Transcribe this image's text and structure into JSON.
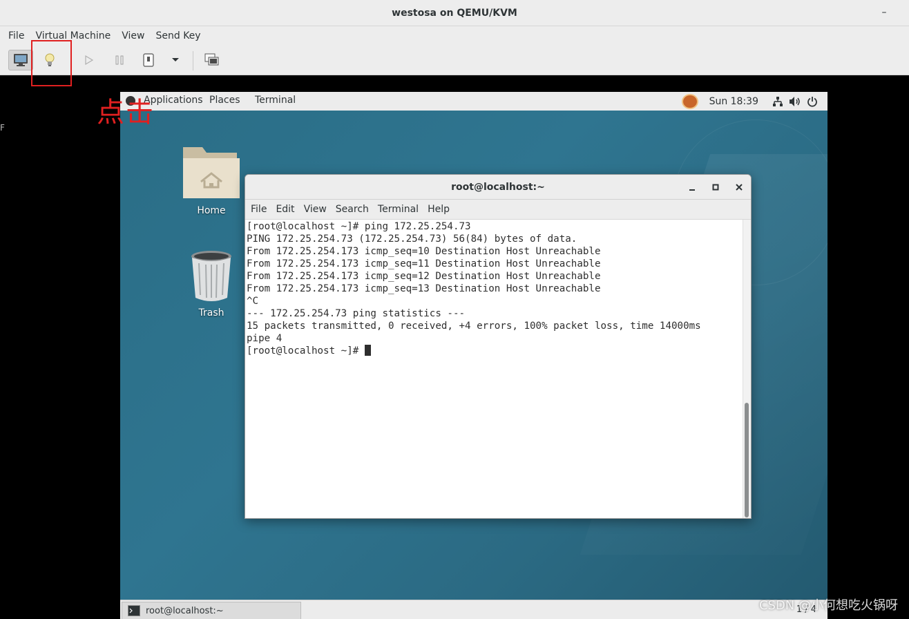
{
  "host": {
    "title": "westosa on QEMU/KVM",
    "minimize_glyph": "–",
    "menu": [
      "File",
      "Virtual Machine",
      "View",
      "Send Key"
    ],
    "toolbar_icons": [
      "monitor-icon",
      "lightbulb-icon",
      "play-icon",
      "pause-icon",
      "power-icon",
      "chevron-down-icon",
      "fullscreen-icon"
    ]
  },
  "annotation": {
    "text": "点击",
    "color": "#e02020"
  },
  "left_artifact": "F",
  "guest": {
    "topbar": {
      "applications": "Applications",
      "places": "Places",
      "terminal": "Terminal",
      "clock": "Sun 18:39"
    },
    "desktop_icons": [
      {
        "label": "Home",
        "icon": "home-folder-icon"
      },
      {
        "label": "Trash",
        "icon": "trash-icon"
      }
    ],
    "terminal_window": {
      "title": "root@localhost:~",
      "menu": [
        "File",
        "Edit",
        "View",
        "Search",
        "Terminal",
        "Help"
      ],
      "lines": [
        "[root@localhost ~]# ping 172.25.254.73",
        "PING 172.25.254.73 (172.25.254.73) 56(84) bytes of data.",
        "From 172.25.254.173 icmp_seq=10 Destination Host Unreachable",
        "From 172.25.254.173 icmp_seq=11 Destination Host Unreachable",
        "From 172.25.254.173 icmp_seq=12 Destination Host Unreachable",
        "From 172.25.254.173 icmp_seq=13 Destination Host Unreachable",
        "^C",
        "--- 172.25.254.73 ping statistics ---",
        "15 packets transmitted, 0 received, +4 errors, 100% packet loss, time 14000ms",
        "pipe 4"
      ],
      "prompt": "[root@localhost ~]# "
    },
    "taskbar": {
      "task_label": "root@localhost:~",
      "pager": "1 / 4"
    }
  },
  "watermark": "CSDN @小何想吃火锅呀",
  "colors": {
    "desktop_bg": "#2f7590",
    "annotation_red": "#e02020"
  }
}
